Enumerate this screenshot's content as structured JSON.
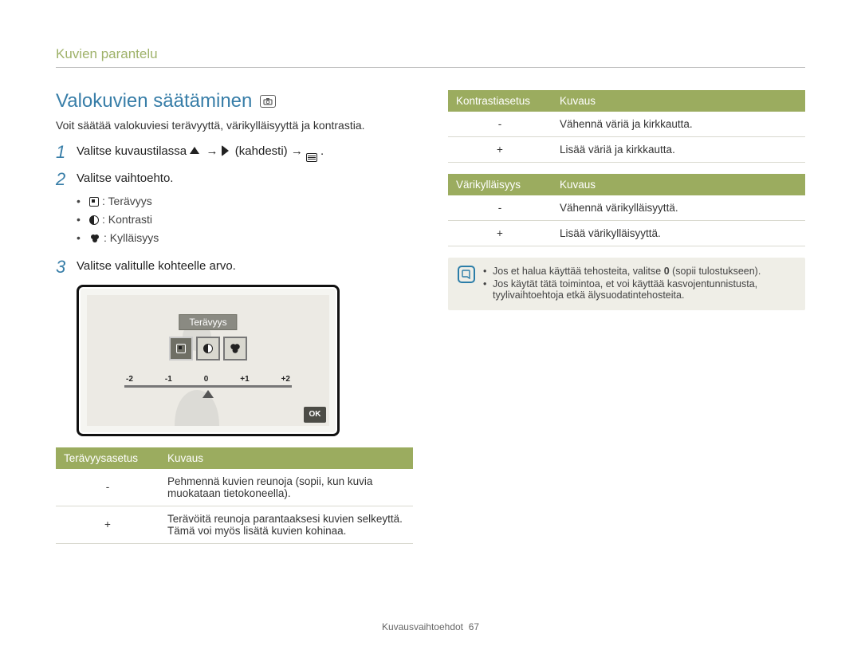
{
  "breadcrumb": "Kuvien parantelu",
  "title": "Valokuvien säätäminen",
  "intro": "Voit säätää valokuviesi terävyyttä, värikylläisyyttä ja kontrastia.",
  "steps": {
    "s1": {
      "num": "1",
      "pre": "Valitse kuvaustilassa ",
      "mid1": " → ",
      "mid2": " (kahdesti) → ",
      "end": "."
    },
    "s2": {
      "num": "2",
      "text": "Valitse vaihtoehto.",
      "bullets": {
        "sharp": ": Terävyys",
        "contrast": ": Kontrasti",
        "sat": ": Kylläisyys"
      }
    },
    "s3": {
      "num": "3",
      "text": "Valitse valitulle kohteelle arvo."
    }
  },
  "lcd": {
    "label": "Terävyys",
    "ok": "OK",
    "ticks": [
      "-2",
      "-1",
      "0",
      "+1",
      "+2"
    ]
  },
  "sharp_table": {
    "h1": "Terävyysasetus",
    "h2": "Kuvaus",
    "r1s": "-",
    "r1d": "Pehmennä kuvien reunoja (sopii, kun kuvia muokataan tietokoneella).",
    "r2s": "+",
    "r2d": "Terävöitä reunoja parantaaksesi kuvien selkeyttä. Tämä voi myös lisätä kuvien kohinaa."
  },
  "contrast_table": {
    "h1": "Kontrastiasetus",
    "h2": "Kuvaus",
    "r1s": "-",
    "r1d": "Vähennä väriä ja kirkkautta.",
    "r2s": "+",
    "r2d": "Lisää väriä ja kirkkautta."
  },
  "sat_table": {
    "h1": "Värikylläisyys",
    "h2": "Kuvaus",
    "r1s": "-",
    "r1d": "Vähennä värikylläisyyttä.",
    "r2s": "+",
    "r2d": "Lisää värikylläisyyttä."
  },
  "note": {
    "t1_a": "Jos et halua käyttää tehosteita, valitse ",
    "t1_b": "0",
    "t1_c": " (sopii tulostukseen).",
    "t2": "Jos käytät tätä toimintoa, et voi käyttää kasvojentunnistusta, tyylivaihtoehtoja etkä älysuodatintehosteita."
  },
  "footer": {
    "label": "Kuvausvaihtoehdot",
    "page": "67"
  }
}
